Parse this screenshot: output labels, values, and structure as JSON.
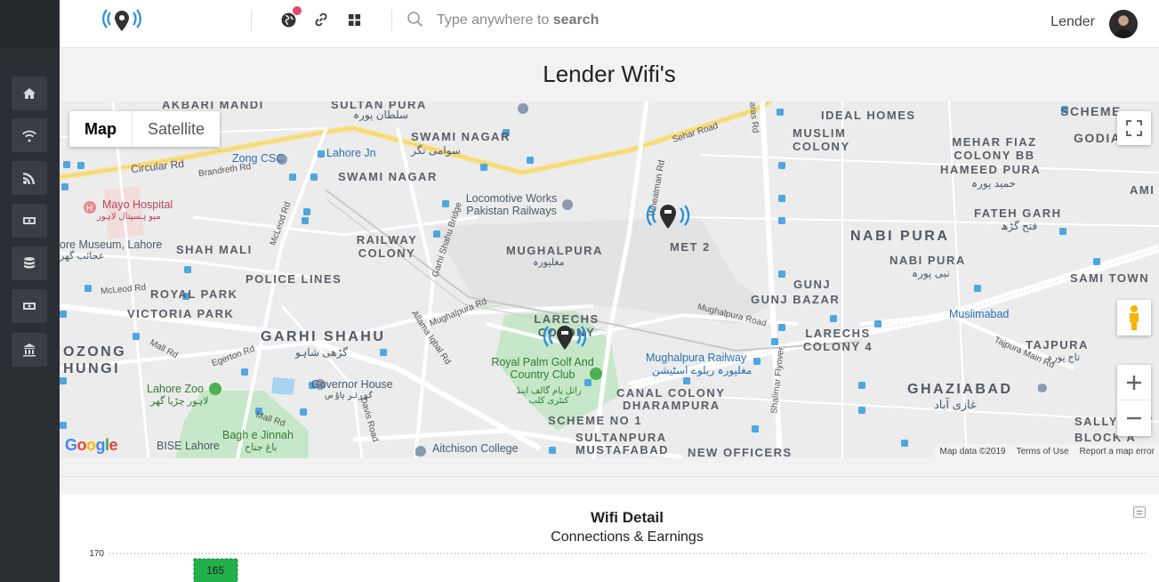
{
  "sidebar": {
    "items": [
      {
        "icon": "home-icon"
      },
      {
        "icon": "wifi-icon"
      },
      {
        "icon": "rss-icon"
      },
      {
        "icon": "money-icon"
      },
      {
        "icon": "database-icon"
      },
      {
        "icon": "cash-icon"
      },
      {
        "icon": "bank-icon"
      }
    ]
  },
  "header": {
    "search_prefix": "Type anywhere to ",
    "search_bold": "search",
    "user_name": "Lender"
  },
  "page": {
    "title": "Lender Wifi's"
  },
  "map": {
    "map_type_options": [
      "Map",
      "Satellite"
    ],
    "selected_map_type": "Map",
    "google_logo": "Google",
    "footer": {
      "data": "Map data ©2019",
      "terms": "Terms of Use",
      "report": "Report a map error"
    },
    "labels": {
      "akbari_mandi": "AKBARI MANDI",
      "sultan_pura": "SULTAN PURA",
      "sultan_pura_urdu": "سلطان پورہ",
      "swami_nagar": "SWAMI NAGAR",
      "swami_nagar_urdu": "سوامی نگر",
      "swami_nagar_2": "SWAMI NAGAR",
      "ideal_homes": "IDEAL HOMES",
      "scheme": "SCHEME",
      "muslim_colony": "MUSLIM COLONY",
      "mehar_fiaz": "MEHAR FIAZ COLONY BB",
      "godian": "GODIAN",
      "hameed_pura": "HAMEED PURA",
      "hameed_pura_urdu": "حمید پورہ",
      "ami": "AMI",
      "circular_rd": "Circular Rd",
      "brandreth_rd": "Brandreth Rd",
      "zong_csc": "Zong CSC",
      "lahore_jn": "Lahore Jn",
      "sehar_road": "Sehar Road",
      "mayo_hospital": "Mayo Hospital",
      "mayo_hospital_urdu": "میو ہسپتال لاہور",
      "locomotive_works": "Locomotive Works Pakistan Railways",
      "fateh_garh": "FATEH GARH",
      "fateh_garh_urdu": "فتح گڑھ",
      "museum": "ore Museum, Lahore",
      "museum_urdu": "عجائب گھر",
      "mcleod_rd_1": "McLeod Rd",
      "railway_colony": "RAILWAY COLONY",
      "mughalpura": "MUGHALPURA",
      "mughalpura_urdu": "مغلپورہ",
      "met2": "MET 2",
      "nabi_pura": "NABI PURA",
      "nabi_pura_2": "NABI PURA",
      "nabi_pura_urdu": "نبی پورہ",
      "shah_mali": "SHAH MALI",
      "police_lines": "POLICE LINES",
      "gunj": "GUNJ",
      "gunj_bazar": "GUNJ BAZAR",
      "sami_town": "SAMI TOWN",
      "royal_park": "ROYAL PARK",
      "mcleod_rd_2": "McLeod Rd",
      "victoria_park": "VICTORIA PARK",
      "mughalpura_rd": "Mughalpura Rd",
      "larechs_colony": "LARECHS COLONY",
      "muslimabad": "Muslimabad",
      "mughalpura_road": "Mughalpura Road",
      "larechs_colony_4": "LARECHS COLONY 4",
      "ozong": "OZONG",
      "hungi": "HUNGI",
      "garhi_shahu": "GARHI SHAHU",
      "garhi_shahu_urdu": "گڑھی شاہو",
      "tajpura": "TAJPURA",
      "tajpura_urdu": "تاج پورہ",
      "royal_palm": "Royal Palm Golf And Country Club",
      "royal_palm_urdu": "رائل پام گالف اینڈ کنٹری کلب",
      "mughalpura_railway": "Mughalpura Railway",
      "mughalpura_railway_urdu": "مغلپورہ ریلوے اسٹیشن",
      "lahore_zoo": "Lahore Zoo",
      "lahore_zoo_urdu": "لاہور چڑیا گھر",
      "governor_house": "Governor House",
      "governor_house_urdu": "گورنر ہاؤس",
      "canal_colony": "CANAL COLONY",
      "dharampura": "DHARAMPURA",
      "ghaziabad": "GHAZIABAD",
      "ghaziabad_urdu": "غازی آباد",
      "scheme_no_1": "SCHEME NO 1",
      "sally_town": "SALLY TOW",
      "bagh_e_jinnah": "Bagh e Jinnah",
      "bagh_e_jinnah_urdu": "باغ جناح",
      "sultanpura": "SULTANPURA",
      "block_a": "BLOCK A",
      "bise_lahore": "BISE Lahore",
      "aitchison_college": "Aitchison College",
      "mustafabad": "MUSTAFABAD",
      "new_officers": "NEW OFFICERS",
      "mall_rd": "Mall Rd",
      "egerton_rd": "Egerton Rd",
      "mall_rd_2": "Mall Rd",
      "davis_road": "Davis Road",
      "allama_iqbal_rd": "Allama Iqbal Rd",
      "shalimar_flyover": "Shalimar Flyover",
      "jaras_rd": "Jaras Rd",
      "wheatman_rd": "Wheatman Rd",
      "mcleod_rd_3": "McLeod Rd",
      "garhi_shahu_bridge": "Garhi Shahu Bridge",
      "tajpura_main_rd": "Tajpura Main Rd",
      "khan_rd": "Mughalpura Rd"
    }
  },
  "chart_data": {
    "type": "bar",
    "title": "Wifi Detail",
    "subtitle": "Connections & Earnings",
    "yticks": [
      170
    ],
    "values": [
      165
    ],
    "data_labels": [
      "165"
    ],
    "bar_color": "#22b04b"
  }
}
